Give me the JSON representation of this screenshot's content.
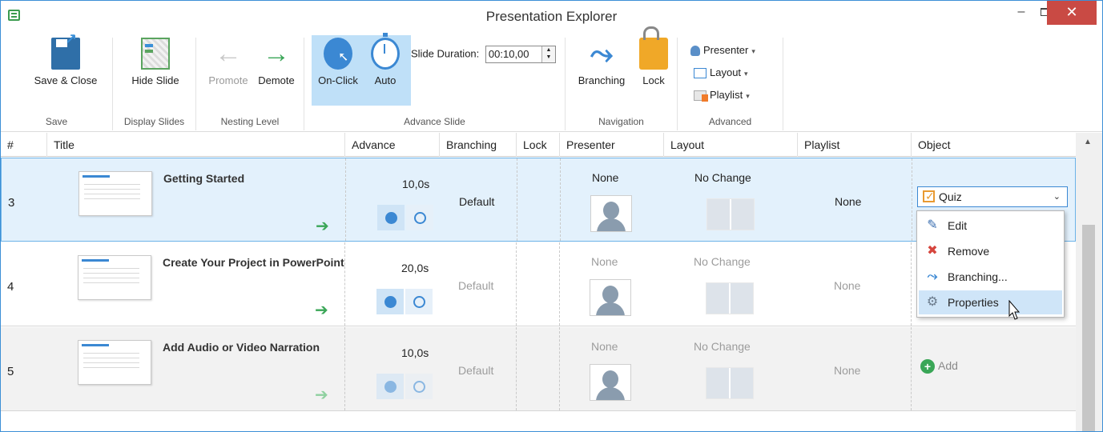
{
  "window": {
    "title": "Presentation Explorer",
    "minimize": "–",
    "close": "✕"
  },
  "ribbon": {
    "save": {
      "button": "Save & Close",
      "group": "Save"
    },
    "display": {
      "button": "Hide Slide",
      "group": "Display Slides"
    },
    "nesting": {
      "promote": "Promote",
      "demote": "Demote",
      "group": "Nesting Level"
    },
    "advance": {
      "on_click": "On-Click",
      "auto": "Auto",
      "duration_label": "Slide Duration:",
      "duration_value": "00:10,00",
      "group": "Advance Slide"
    },
    "navigation": {
      "branching": "Branching",
      "lock": "Lock",
      "group": "Navigation"
    },
    "advanced": {
      "presenter": "Presenter",
      "layout": "Layout",
      "playlist": "Playlist",
      "group": "Advanced"
    }
  },
  "table": {
    "headers": {
      "num": "#",
      "title": "Title",
      "advance": "Advance",
      "branching": "Branching",
      "lock": "Lock",
      "presenter": "Presenter",
      "layout": "Layout",
      "playlist": "Playlist",
      "object": "Object"
    },
    "rows": [
      {
        "num": "3",
        "title": "Getting Started",
        "advance": "10,0s",
        "branching": "Default",
        "presenter": "None",
        "layout": "No Change",
        "playlist": "None",
        "object": "Quiz"
      },
      {
        "num": "4",
        "title": "Create Your Project in PowerPoint",
        "advance": "20,0s",
        "branching": "Default",
        "presenter": "None",
        "layout": "No Change",
        "playlist": "None"
      },
      {
        "num": "5",
        "title": "Add Audio or Video Narration",
        "advance": "10,0s",
        "branching": "Default",
        "presenter": "None",
        "layout": "No Change",
        "playlist": "None",
        "object_add": "Add"
      }
    ]
  },
  "object_menu": {
    "edit": "Edit",
    "remove": "Remove",
    "branching": "Branching...",
    "properties": "Properties"
  },
  "colors": {
    "accent": "#3b88d3",
    "green": "#3aa657",
    "close_red": "#c94a44",
    "selected_row": "#e3f1fc"
  }
}
